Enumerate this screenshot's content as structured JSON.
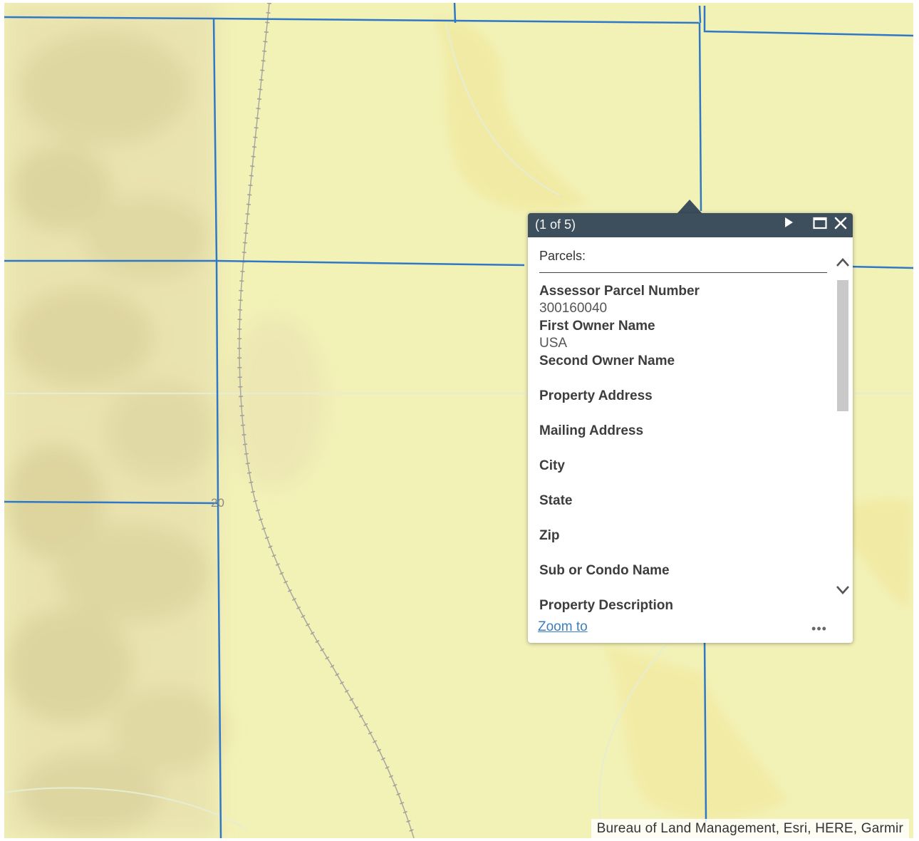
{
  "map": {
    "section_number": "20",
    "attribution": "Bureau of Land Management, Esri, HERE, Garmir",
    "colors": {
      "background": "#f2f1b6",
      "parcel_line": "#2f78c8",
      "terrain_shade": "#ddd3a4",
      "trail": "#a8a8a0"
    }
  },
  "popup": {
    "count_label": "(1 of 5)",
    "header_color": "#3d4f5c",
    "layer_title": "Parcels:",
    "fields": [
      {
        "label": "Assessor Parcel Number",
        "value": "300160040"
      },
      {
        "label": "First Owner Name",
        "value": "USA"
      },
      {
        "label": "Second Owner Name",
        "value": ""
      },
      {
        "label": "Property Address",
        "value": ""
      },
      {
        "label": "Mailing Address",
        "value": ""
      },
      {
        "label": "City",
        "value": ""
      },
      {
        "label": "State",
        "value": ""
      },
      {
        "label": "Zip",
        "value": ""
      },
      {
        "label": "Sub or Condo Name",
        "value": ""
      },
      {
        "label": "Property Description",
        "value": ""
      }
    ],
    "zoom_to_label": "Zoom to",
    "more_label": "•••",
    "icons": {
      "next": "play-icon",
      "maximize": "maximize-icon",
      "close": "close-icon",
      "scroll_up": "chevron-up-icon",
      "scroll_down": "chevron-down-icon"
    }
  }
}
